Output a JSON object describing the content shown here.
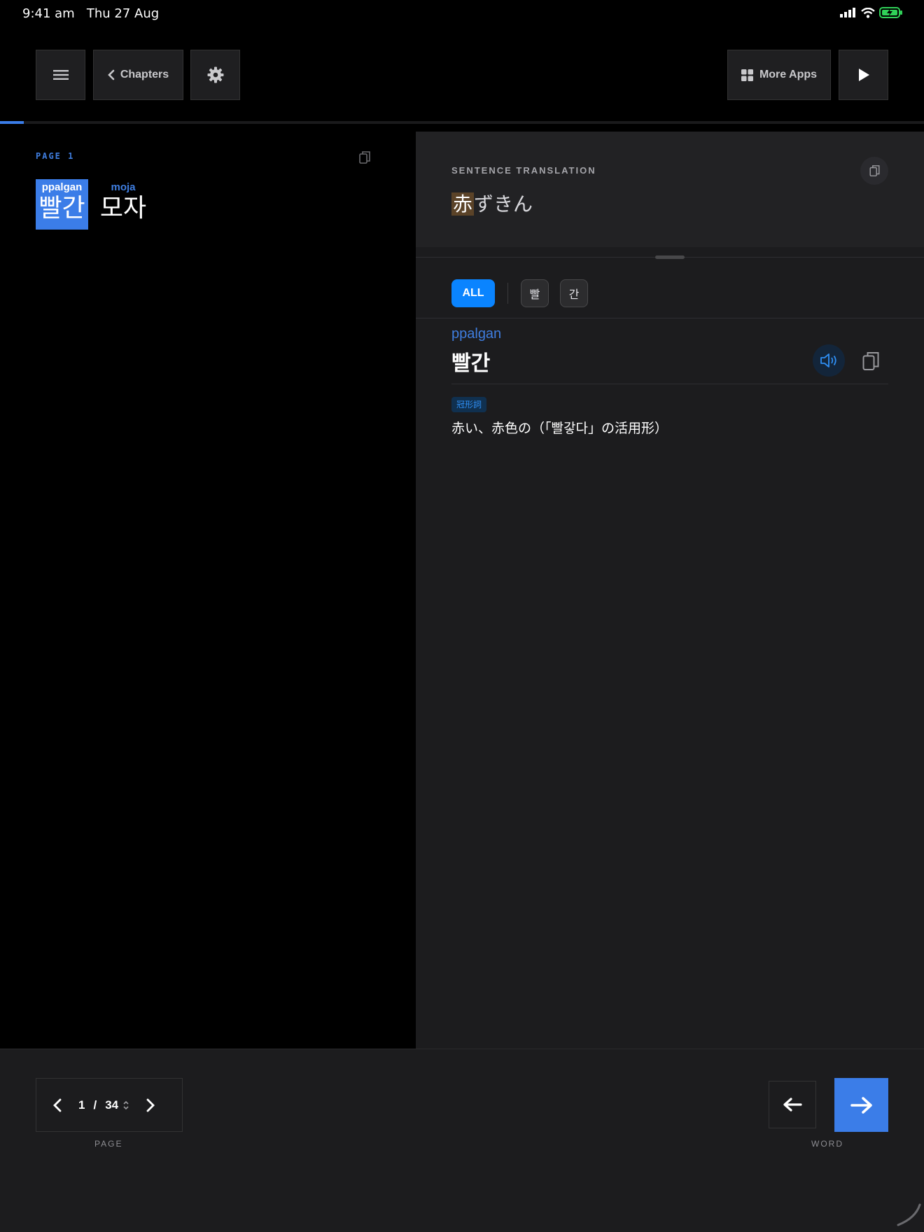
{
  "status_bar": {
    "time": "9:41 am",
    "date": "Thu 27 Aug"
  },
  "toolbar": {
    "chapters_label": "Chapters",
    "more_apps_label": "More Apps"
  },
  "reading": {
    "progress": 0.026,
    "page_label": "PAGE 1",
    "words": [
      {
        "romanization": "ppalgan",
        "hangul": "빨간",
        "selected": true
      },
      {
        "romanization": "moja",
        "hangul": "모자",
        "selected": false
      }
    ]
  },
  "translation": {
    "heading": "SENTENCE TRANSLATION",
    "highlighted": "赤",
    "rest": "ずきん"
  },
  "filters": {
    "all_label": "ALL",
    "syllables": [
      "빨",
      "간"
    ]
  },
  "entry": {
    "romanization": "ppalgan",
    "word": "빨간",
    "part_of_speech": "冠形詞",
    "definition": "赤い、赤色の（「빨갛다」の活用形）"
  },
  "pager": {
    "current": "1",
    "separator": "/",
    "total": "34",
    "caption": "PAGE"
  },
  "word_nav": {
    "caption": "WORD"
  },
  "colors": {
    "accent": "#3b7de8",
    "chip_active": "#0a84ff",
    "panel": "#1c1c1e"
  }
}
